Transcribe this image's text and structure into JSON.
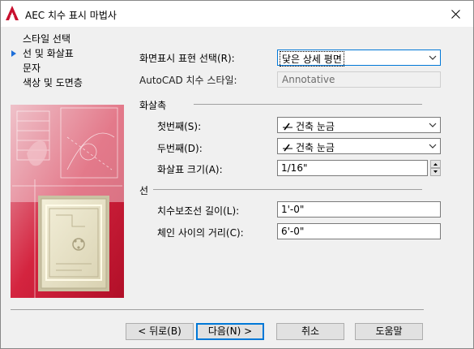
{
  "window": {
    "title": "AEC 치수 표시 마법사"
  },
  "nav": {
    "items": [
      {
        "label": "스타일 선택",
        "current": false
      },
      {
        "label": "선 및 화살표",
        "current": true
      },
      {
        "label": "문자",
        "current": false
      },
      {
        "label": "색상 및 도면층",
        "current": false
      }
    ]
  },
  "form": {
    "display_rep": {
      "label": "화면표시 표현 선택(R):",
      "value": "닻은 상세 평면"
    },
    "autocad_style": {
      "label": "AutoCAD 치수 스타일:",
      "value": "Annotative"
    },
    "arrows": {
      "section": "화살촉",
      "first": {
        "label": "첫번째(S):",
        "value": "건축 눈금"
      },
      "second": {
        "label": "두번째(D):",
        "value": "건축 눈금"
      },
      "size": {
        "label": "화살표 크기(A):",
        "value": "1/16\""
      }
    },
    "lines": {
      "section": "선",
      "extension": {
        "label": "치수보조선 길이(L):",
        "value": "1'-0\""
      },
      "chain_distance": {
        "label": "체인 사이의 거리(C):",
        "value": "6'-0\""
      }
    }
  },
  "buttons": {
    "back": "< 뒤로(B)",
    "next": "다음(N) >",
    "cancel": "취소",
    "help": "도움말"
  },
  "colors": {
    "accent": "#0078d7",
    "brand_red": "#c8102e",
    "nav_arrow": "#1e6fd9"
  }
}
